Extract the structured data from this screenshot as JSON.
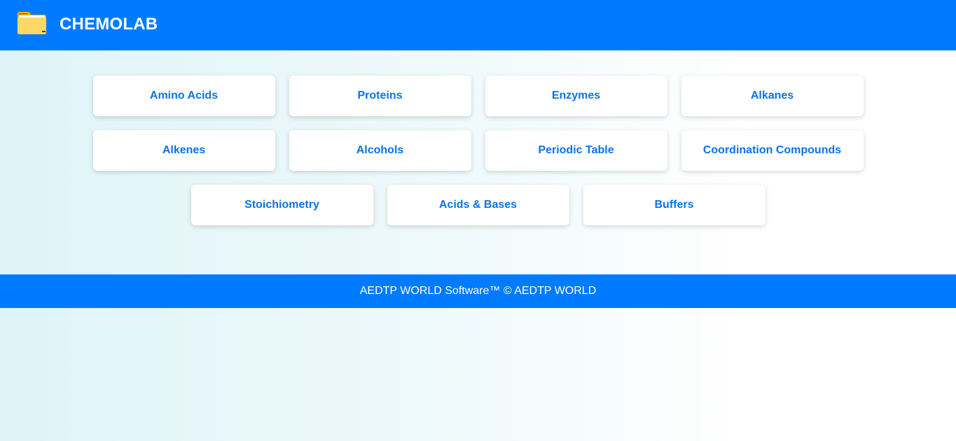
{
  "header": {
    "title": "CHEMOLAB",
    "icon": "folder-icon"
  },
  "topics": [
    {
      "label": "Amino Acids"
    },
    {
      "label": "Proteins"
    },
    {
      "label": "Enzymes"
    },
    {
      "label": "Alkanes"
    },
    {
      "label": "Alkenes"
    },
    {
      "label": "Alcohols"
    },
    {
      "label": "Periodic Table"
    },
    {
      "label": "Coordination Compounds"
    },
    {
      "label": "Stoichiometry"
    },
    {
      "label": "Acids & Bases"
    },
    {
      "label": "Buffers"
    }
  ],
  "footer": {
    "text": "AEDTP WORLD Software™ © AEDTP WORLD"
  },
  "colors": {
    "header_background": "#007bff",
    "button_text": "#0a73e8",
    "button_background": "#ffffff"
  }
}
